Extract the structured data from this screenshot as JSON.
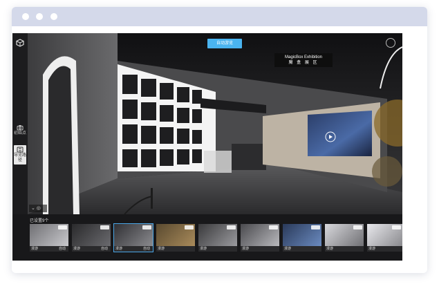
{
  "top_button": {
    "label": "自动游览"
  },
  "exhibit_sign": {
    "line1": "MagicBox Exhibition",
    "line2": "魔 盒 展 区"
  },
  "left_tools": [
    {
      "label": "初始点",
      "icon": "camera-icon"
    },
    {
      "label": "导览路径",
      "icon": "path-icon"
    }
  ],
  "strip": {
    "title": "已设置9个",
    "thumbs": [
      {
        "left": "漫游",
        "right": "自动"
      },
      {
        "left": "漫游",
        "right": "自动"
      },
      {
        "left": "漫游",
        "right": "自动"
      },
      {
        "left": "漫游",
        "right": ""
      },
      {
        "left": "漫游",
        "right": ""
      },
      {
        "left": "漫游",
        "right": ""
      },
      {
        "left": "漫游",
        "right": ""
      },
      {
        "left": "漫游",
        "right": ""
      },
      {
        "left": "漫游",
        "right": ""
      }
    ]
  },
  "colors": {
    "accent": "#4ab4f0",
    "titlebar": "#d4d9ea",
    "active_thumb": "#4aa7e8"
  }
}
